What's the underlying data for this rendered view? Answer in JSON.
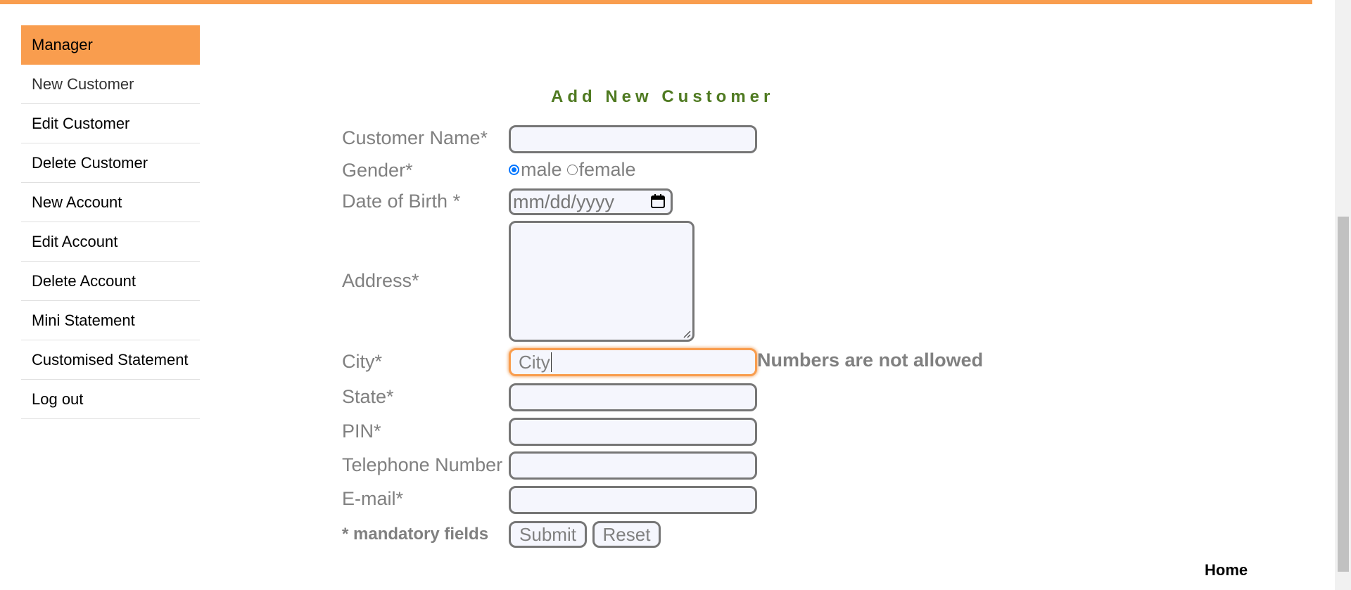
{
  "colors": {
    "accent": "#f99d4e",
    "title": "#4f7a21",
    "label": "#808080",
    "radio_checked": "#0075ff"
  },
  "sidebar": {
    "items": [
      {
        "label": "Manager",
        "active": true
      },
      {
        "label": "New Customer"
      },
      {
        "label": "Edit Customer"
      },
      {
        "label": "Delete Customer"
      },
      {
        "label": "New Account"
      },
      {
        "label": "Edit Account"
      },
      {
        "label": "Delete Account"
      },
      {
        "label": "Mini Statement"
      },
      {
        "label": "Customised Statement"
      },
      {
        "label": "Log out"
      }
    ]
  },
  "form": {
    "title": "Add New Customer",
    "customer_name": {
      "label": "Customer Name*",
      "value": ""
    },
    "gender": {
      "label": "Gender*",
      "options": [
        "male",
        "female"
      ],
      "selected": "male"
    },
    "dob": {
      "label": "Date of Birth *",
      "placeholder": "mm/dd/yyyy",
      "icon": "calendar-icon"
    },
    "address": {
      "label": "Address*",
      "value": ""
    },
    "city": {
      "label": "City*",
      "value": "City",
      "error": "Numbers are not allowed"
    },
    "state": {
      "label": "State*",
      "value": ""
    },
    "pin": {
      "label": "PIN*",
      "value": ""
    },
    "telephone": {
      "label": "Telephone Number",
      "value": ""
    },
    "email": {
      "label": "E-mail*",
      "value": ""
    },
    "mandatory_note": "* mandatory fields",
    "submit_label": "Submit",
    "reset_label": "Reset"
  },
  "footer": {
    "home_label": "Home"
  }
}
